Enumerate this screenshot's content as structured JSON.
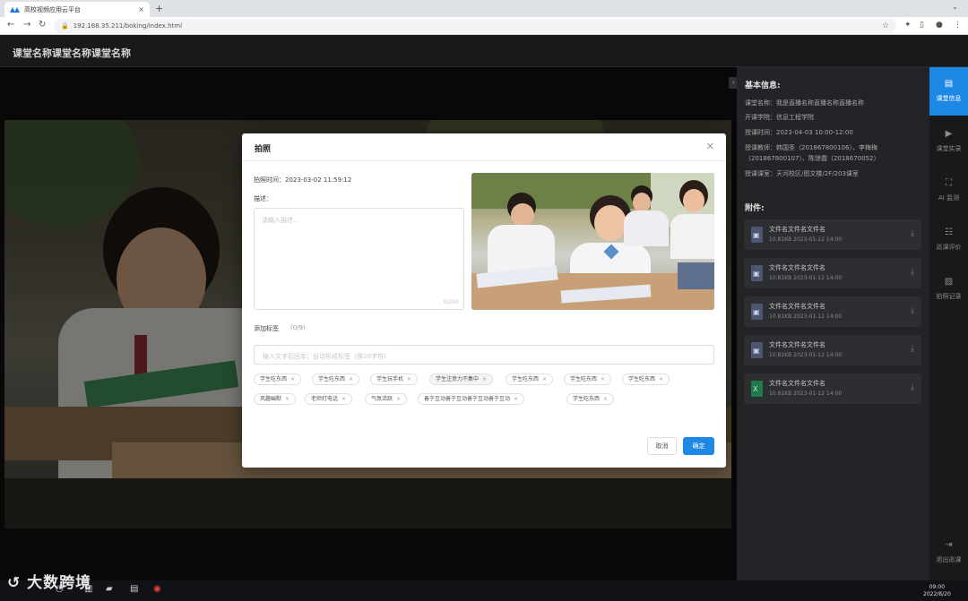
{
  "browser": {
    "tab_title": "高校视频应用云平台",
    "url": "192.168.35.211/boking/index.html"
  },
  "app": {
    "title": "课堂名称课堂名称课堂名称"
  },
  "info_panel": {
    "basic_heading": "基本信息:",
    "fields": [
      "课堂名称：我是直播名称直播名称直播名称",
      "开课学院：信息工程学院",
      "授课时间：2023-04-03  10:00-12:00",
      "授课教师：韩国圣（201867800106）、李梅梅（201867800107）、陈琼霞（2018670052）",
      "授课课室：天河校区/图文楼/2F/203课室"
    ],
    "attach_heading": "附件:",
    "attachments": [
      {
        "name": "文件名文件名文件名",
        "meta": "10.81KB    2023-01-12 14:00",
        "icon": "image-file-icon"
      },
      {
        "name": "文件名文件名文件名",
        "meta": "10.81KB    2023-01-12 14:00",
        "icon": "image-file-icon"
      },
      {
        "name": "文件名文件名文件名",
        "meta": "10.81KB    2023-01-12 14:00",
        "icon": "image-file-icon"
      },
      {
        "name": "文件名文件名文件名",
        "meta": "10.81KB    2023-01-12 14:00",
        "icon": "image-file-icon"
      },
      {
        "name": "文件名文件名文件名",
        "meta": "10.81KB    2023-01-12 14:00",
        "icon": "excel-file-icon"
      }
    ]
  },
  "rail": {
    "items": [
      "课堂信息",
      "课堂实录",
      "AI 监测",
      "巡课评价",
      "拍照记录"
    ],
    "exit": "退出巡课"
  },
  "modal": {
    "title": "拍照",
    "time_label": "拍照时间：2023-03-02 11:59:12",
    "desc_label": "描述：",
    "desc_placeholder": "请输入描述...",
    "desc_count": "0/200",
    "tags_label": "添加标签",
    "tags_count": "(0/9)",
    "tag_input_placeholder": "输入文字后回车，自动形成标签（限20字符）",
    "tags_row1": [
      "学生吃东西",
      "学生吃东西",
      "学生玩手机",
      "学生注意力不集中",
      "学生吃东西",
      "学生吃东西",
      "学生吃东西"
    ],
    "tags_row2": [
      "风趣幽默",
      "老师打电话",
      "气氛活跃",
      "善于互动善于互动善于互动善于互动",
      "学生吃东西"
    ],
    "cancel": "取消",
    "ok": "确定"
  },
  "taskbar": {
    "watermark": "大数跨境",
    "time": "09:00",
    "date": "2022/8/20"
  },
  "colors": {
    "accent": "#1e88e5",
    "dark_bg": "#18191b",
    "panel_bg": "#232427"
  }
}
